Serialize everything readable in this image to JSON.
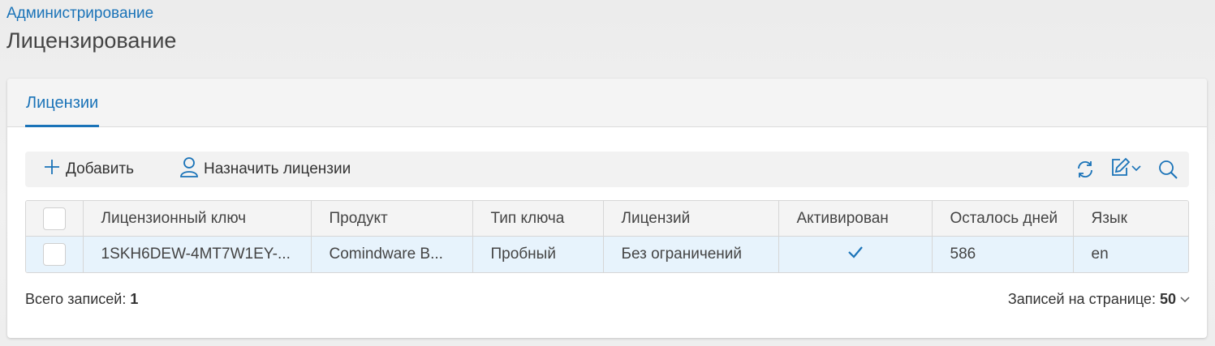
{
  "breadcrumb": "Администрирование",
  "page_title": "Лицензирование",
  "tabs": [
    {
      "label": "Лицензии"
    }
  ],
  "toolbar": {
    "add_label": "Добавить",
    "assign_label": "Назначить лицензии",
    "icons": [
      "plus-icon",
      "user-icon",
      "refresh-icon",
      "edit-icon",
      "chevron-down-icon",
      "search-icon"
    ]
  },
  "table": {
    "columns": [
      "Лицензионный ключ",
      "Продукт",
      "Тип ключа",
      "Лицензий",
      "Активирован",
      "Осталось дней",
      "Язык"
    ],
    "rows": [
      {
        "key": "1SKH6DEW-4MT7W1EY-...",
        "product": "Comindware B...",
        "key_type": "Пробный",
        "licenses": "Без ограничений",
        "activated": "✓",
        "days_left": "586",
        "language": "en"
      }
    ]
  },
  "footer": {
    "total_label": "Всего записей:",
    "total_value": "1",
    "per_page_label": "Записей на странице:",
    "per_page_value": "50"
  },
  "colors": {
    "accent": "#1a73b8",
    "row_selected": "#e7f3fc"
  }
}
